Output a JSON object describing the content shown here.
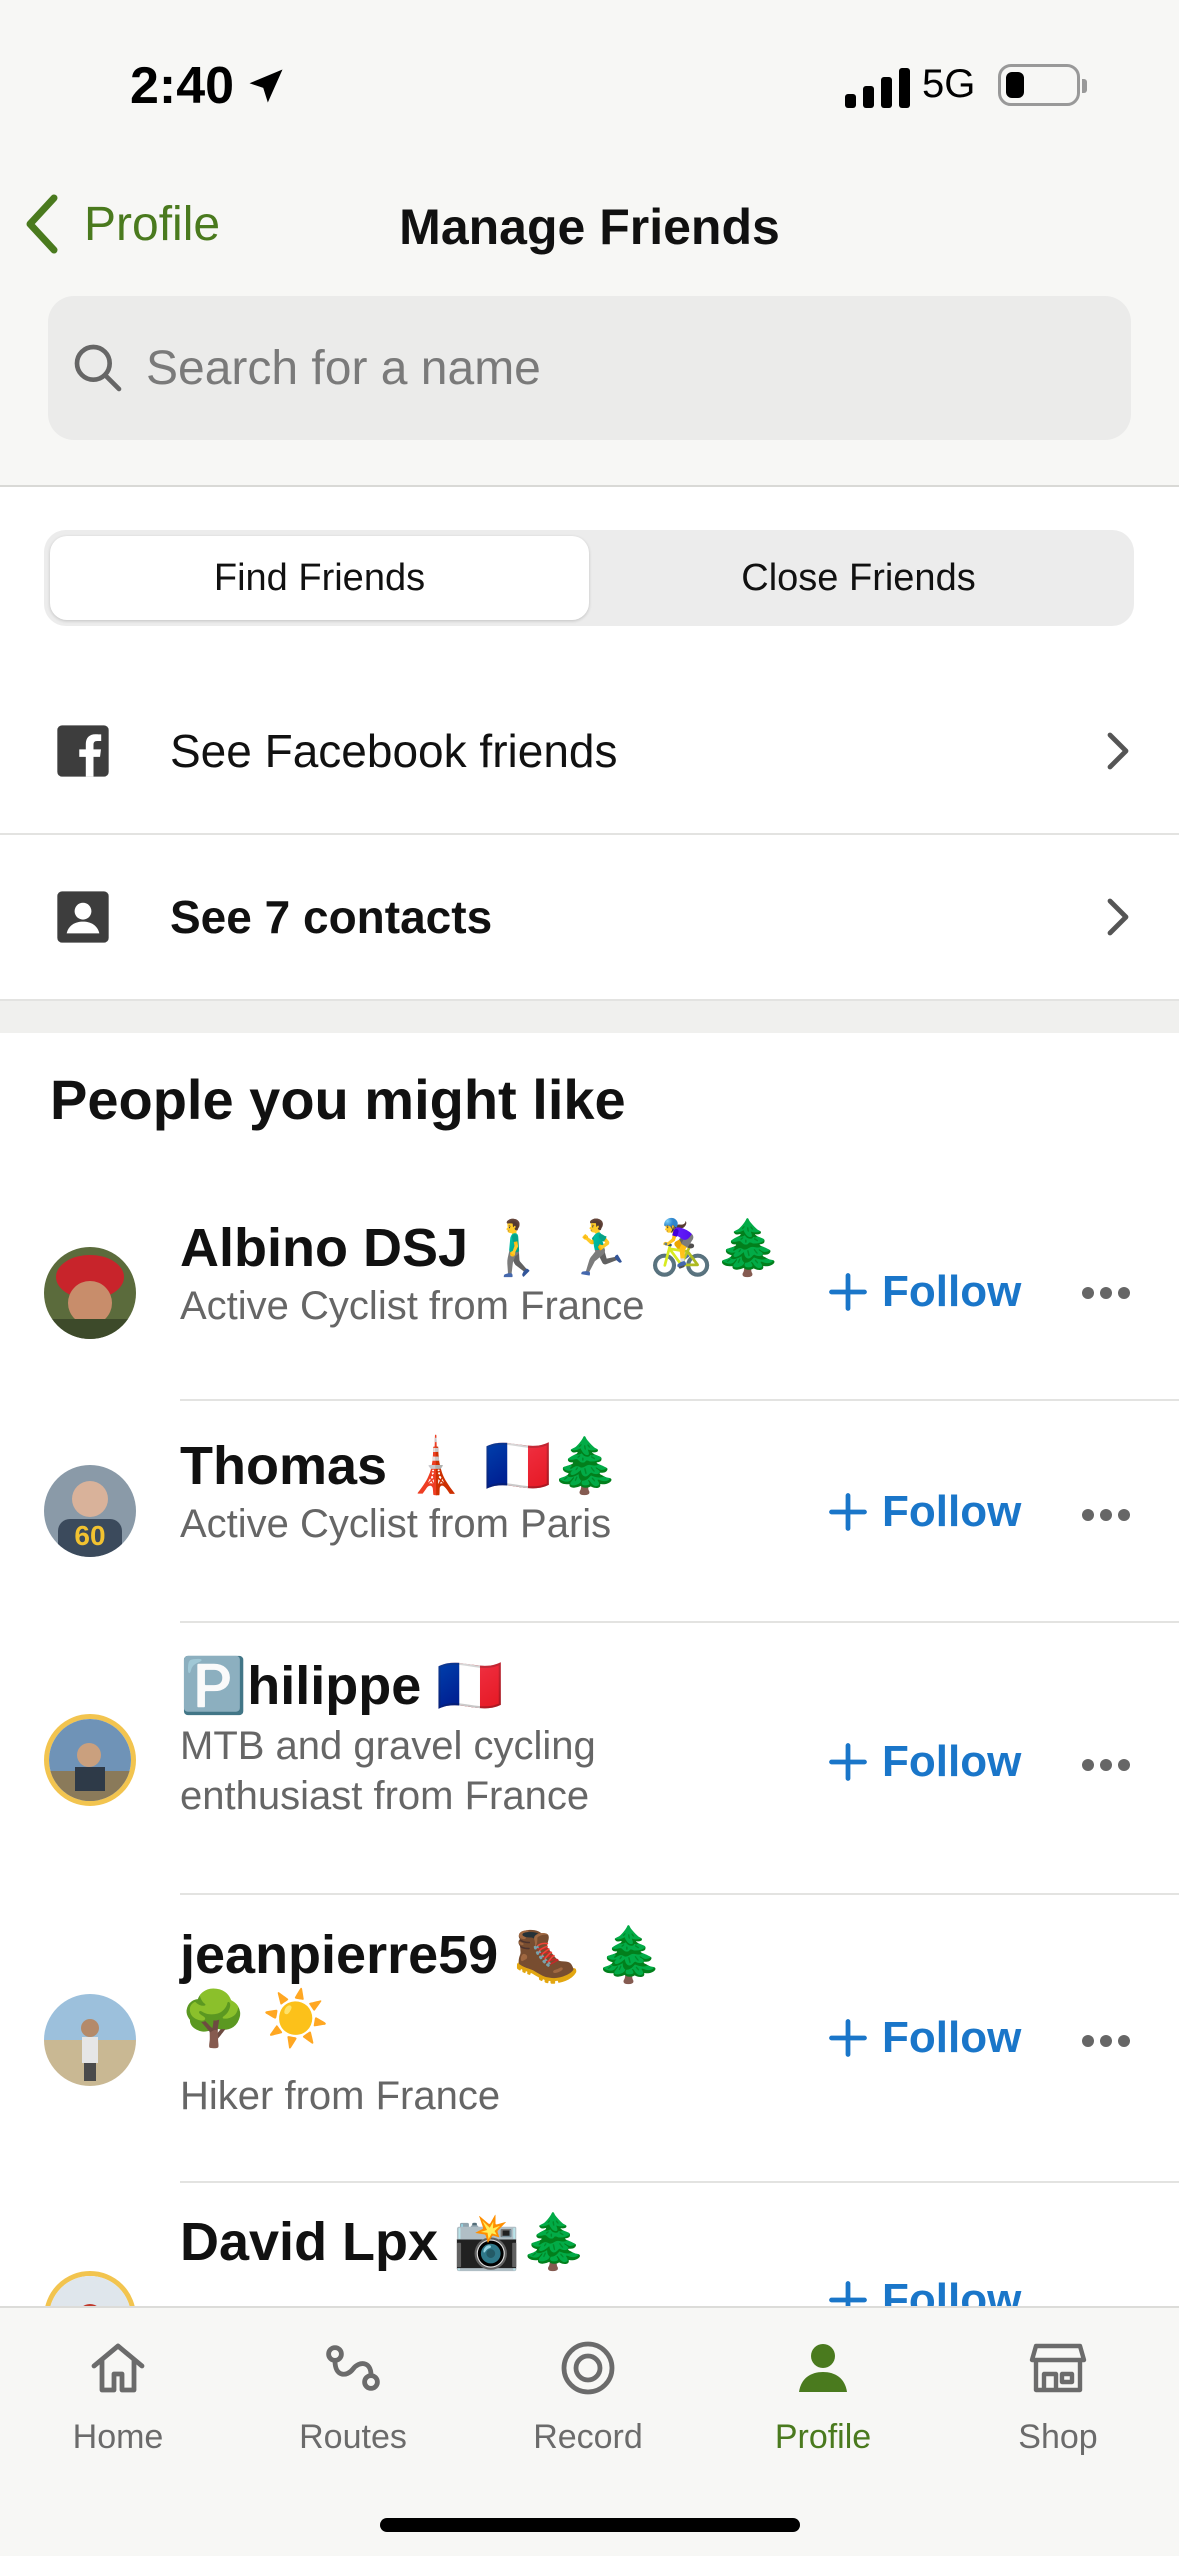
{
  "status_bar": {
    "time": "2:40",
    "network": "5G"
  },
  "nav": {
    "back_label": "Profile",
    "title": "Manage Friends"
  },
  "search": {
    "placeholder": "Search for a name"
  },
  "segments": [
    {
      "label": "Find Friends",
      "selected": true
    },
    {
      "label": "Close Friends",
      "selected": false
    }
  ],
  "links": {
    "facebook": "See Facebook friends",
    "contacts": "See 7 contacts"
  },
  "section_title": "People you might like",
  "people": [
    {
      "name": "Albino DSJ 🚶‍♂️ 🏃‍♂️ 🚴‍♀️🌲",
      "description": "Active Cyclist from France",
      "follow_label": "Follow"
    },
    {
      "name": "Thomas 🗼 🇫🇷🌲",
      "description": "Active Cyclist from Paris",
      "follow_label": "Follow"
    },
    {
      "name": "🅿️hilippe 🇫🇷",
      "description": "MTB and gravel cycling enthusiast from France",
      "follow_label": "Follow"
    },
    {
      "name": "jeanpierre59 🥾 🌲 🌳 ☀️",
      "description": "Hiker from France",
      "follow_label": "Follow"
    },
    {
      "name": "David Lpx 📸🌲",
      "description": "",
      "follow_label": "Follow"
    }
  ],
  "tabs": [
    {
      "label": "Home",
      "icon": "home-icon"
    },
    {
      "label": "Routes",
      "icon": "routes-icon"
    },
    {
      "label": "Record",
      "icon": "record-icon"
    },
    {
      "label": "Profile",
      "icon": "profile-icon",
      "active": true
    },
    {
      "label": "Shop",
      "icon": "shop-icon"
    }
  ],
  "colors": {
    "accent_green": "#4a7a1e",
    "follow_blue": "#1a76c9"
  }
}
